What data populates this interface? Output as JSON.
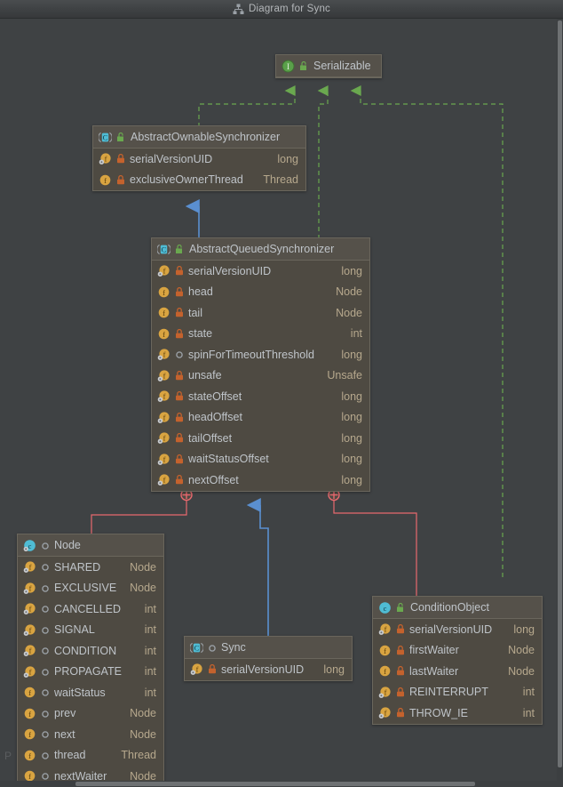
{
  "window": {
    "title": "Diagram for Sync",
    "title_icon": "diagram-hierarchy-icon"
  },
  "watermark": "P",
  "colors": {
    "background": "#3f4244",
    "titlebar": "#3f4244",
    "node_body": "#4e4a42",
    "node_header": "#55514a",
    "node_border": "#6a665c",
    "text": "#bfc4c9",
    "type_text": "#b6a88d",
    "implements_green": "#6aa84f",
    "extends_blue": "#5a8fd0",
    "inner_class_red": "#e8696e",
    "icon_class_teal": "#4fbcd4",
    "icon_interface_green": "#5aa04a",
    "icon_field_orange": "#d9a441",
    "icon_private_red": "#c4622d",
    "icon_package_grey": "#8a8d90"
  },
  "nodes": [
    {
      "id": "serializable",
      "name": "Serializable",
      "kind_icon": "interface-icon",
      "marker_icon": "package-private-marker-icon",
      "fields": []
    },
    {
      "id": "abstract-ownable-synchronizer",
      "name": "AbstractOwnableSynchronizer",
      "kind_icon": "abstract-class-icon",
      "marker_icon": "package-private-marker-icon",
      "fields": [
        {
          "name": "serialVersionUID",
          "type": "long",
          "icon": "static-field-icon",
          "visibility_icon": "private-lock-icon"
        },
        {
          "name": "exclusiveOwnerThread",
          "type": "Thread",
          "icon": "field-icon",
          "visibility_icon": "private-lock-icon"
        }
      ]
    },
    {
      "id": "abstract-queued-synchronizer",
      "name": "AbstractQueuedSynchronizer",
      "kind_icon": "abstract-class-icon",
      "marker_icon": "package-private-marker-icon",
      "fields": [
        {
          "name": "serialVersionUID",
          "type": "long",
          "icon": "static-field-icon",
          "visibility_icon": "private-lock-icon"
        },
        {
          "name": "head",
          "type": "Node",
          "icon": "field-icon",
          "visibility_icon": "private-lock-icon"
        },
        {
          "name": "tail",
          "type": "Node",
          "icon": "field-icon",
          "visibility_icon": "private-lock-icon"
        },
        {
          "name": "state",
          "type": "int",
          "icon": "field-icon",
          "visibility_icon": "private-lock-icon"
        },
        {
          "name": "spinForTimeoutThreshold",
          "type": "long",
          "icon": "static-field-icon",
          "visibility_icon": "package-private-icon"
        },
        {
          "name": "unsafe",
          "type": "Unsafe",
          "icon": "static-field-icon",
          "visibility_icon": "private-lock-icon"
        },
        {
          "name": "stateOffset",
          "type": "long",
          "icon": "static-field-icon",
          "visibility_icon": "private-lock-icon"
        },
        {
          "name": "headOffset",
          "type": "long",
          "icon": "static-field-icon",
          "visibility_icon": "private-lock-icon"
        },
        {
          "name": "tailOffset",
          "type": "long",
          "icon": "static-field-icon",
          "visibility_icon": "private-lock-icon"
        },
        {
          "name": "waitStatusOffset",
          "type": "long",
          "icon": "static-field-icon",
          "visibility_icon": "private-lock-icon"
        },
        {
          "name": "nextOffset",
          "type": "long",
          "icon": "static-field-icon",
          "visibility_icon": "private-lock-icon"
        }
      ]
    },
    {
      "id": "node",
      "name": "Node",
      "kind_icon": "class-icon",
      "marker_icon": "package-private-icon",
      "fields": [
        {
          "name": "SHARED",
          "type": "Node",
          "icon": "static-field-icon",
          "visibility_icon": "package-private-icon"
        },
        {
          "name": "EXCLUSIVE",
          "type": "Node",
          "icon": "static-field-icon",
          "visibility_icon": "package-private-icon"
        },
        {
          "name": "CANCELLED",
          "type": "int",
          "icon": "static-field-icon",
          "visibility_icon": "package-private-icon"
        },
        {
          "name": "SIGNAL",
          "type": "int",
          "icon": "static-field-icon",
          "visibility_icon": "package-private-icon"
        },
        {
          "name": "CONDITION",
          "type": "int",
          "icon": "static-field-icon",
          "visibility_icon": "package-private-icon"
        },
        {
          "name": "PROPAGATE",
          "type": "int",
          "icon": "static-field-icon",
          "visibility_icon": "package-private-icon"
        },
        {
          "name": "waitStatus",
          "type": "int",
          "icon": "field-icon",
          "visibility_icon": "package-private-icon"
        },
        {
          "name": "prev",
          "type": "Node",
          "icon": "field-icon",
          "visibility_icon": "package-private-icon"
        },
        {
          "name": "next",
          "type": "Node",
          "icon": "field-icon",
          "visibility_icon": "package-private-icon"
        },
        {
          "name": "thread",
          "type": "Thread",
          "icon": "field-icon",
          "visibility_icon": "package-private-icon"
        },
        {
          "name": "nextWaiter",
          "type": "Node",
          "icon": "field-icon",
          "visibility_icon": "package-private-icon"
        }
      ]
    },
    {
      "id": "sync",
      "name": "Sync",
      "kind_icon": "abstract-class-icon",
      "marker_icon": "package-private-icon",
      "fields": [
        {
          "name": "serialVersionUID",
          "type": "long",
          "icon": "static-field-icon",
          "visibility_icon": "private-lock-icon"
        }
      ]
    },
    {
      "id": "condition-object",
      "name": "ConditionObject",
      "kind_icon": "class-icon",
      "marker_icon": "package-private-marker-icon",
      "fields": [
        {
          "name": "serialVersionUID",
          "type": "long",
          "icon": "static-field-icon",
          "visibility_icon": "private-lock-icon"
        },
        {
          "name": "firstWaiter",
          "type": "Node",
          "icon": "field-icon",
          "visibility_icon": "private-lock-icon"
        },
        {
          "name": "lastWaiter",
          "type": "Node",
          "icon": "field-icon",
          "visibility_icon": "private-lock-icon"
        },
        {
          "name": "REINTERRUPT",
          "type": "int",
          "icon": "static-field-icon",
          "visibility_icon": "private-lock-icon"
        },
        {
          "name": "THROW_IE",
          "type": "int",
          "icon": "static-field-icon",
          "visibility_icon": "private-lock-icon"
        }
      ]
    }
  ],
  "edges": [
    {
      "from": "abstract-ownable-synchronizer",
      "to": "serializable",
      "kind": "implements"
    },
    {
      "from": "abstract-queued-synchronizer",
      "to": "serializable",
      "kind": "implements"
    },
    {
      "from": "condition-object",
      "to": "serializable",
      "kind": "implements"
    },
    {
      "from": "abstract-queued-synchronizer",
      "to": "abstract-ownable-synchronizer",
      "kind": "extends"
    },
    {
      "from": "sync",
      "to": "abstract-queued-synchronizer",
      "kind": "extends"
    },
    {
      "from": "node",
      "to": "abstract-queued-synchronizer",
      "kind": "inner-class"
    },
    {
      "from": "condition-object",
      "to": "abstract-queued-synchronizer",
      "kind": "inner-class"
    }
  ]
}
